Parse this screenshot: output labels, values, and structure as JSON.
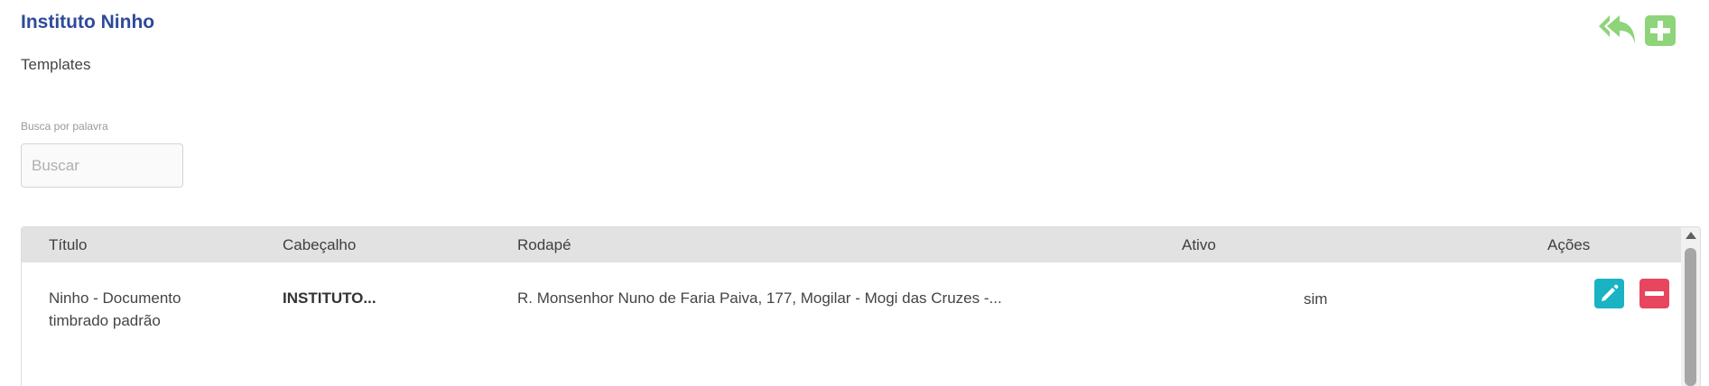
{
  "header": {
    "title": "Instituto Ninho",
    "subtitle": "Templates"
  },
  "toolbar": {
    "back_icon": "reply-all-icon",
    "add_icon": "plus-icon",
    "accent": "#8ed47a"
  },
  "search": {
    "label": "Busca por palavra",
    "placeholder": "Buscar",
    "value": ""
  },
  "table": {
    "columns": [
      "Título",
      "Cabeçalho",
      "Rodapé",
      "Ativo",
      "Ações"
    ],
    "rows": [
      {
        "titulo": "Ninho - Documento timbrado padrão",
        "cabecalho": "INSTITUTO...",
        "rodape": "R. Monsenhor Nuno de Faria Paiva, 177, Mogilar - Mogi das Cruzes -...",
        "ativo": "sim",
        "actions": [
          {
            "icon": "pencil-icon",
            "color": "#19b3c4"
          },
          {
            "icon": "minus-icon",
            "color": "#e8455e"
          }
        ]
      }
    ]
  }
}
